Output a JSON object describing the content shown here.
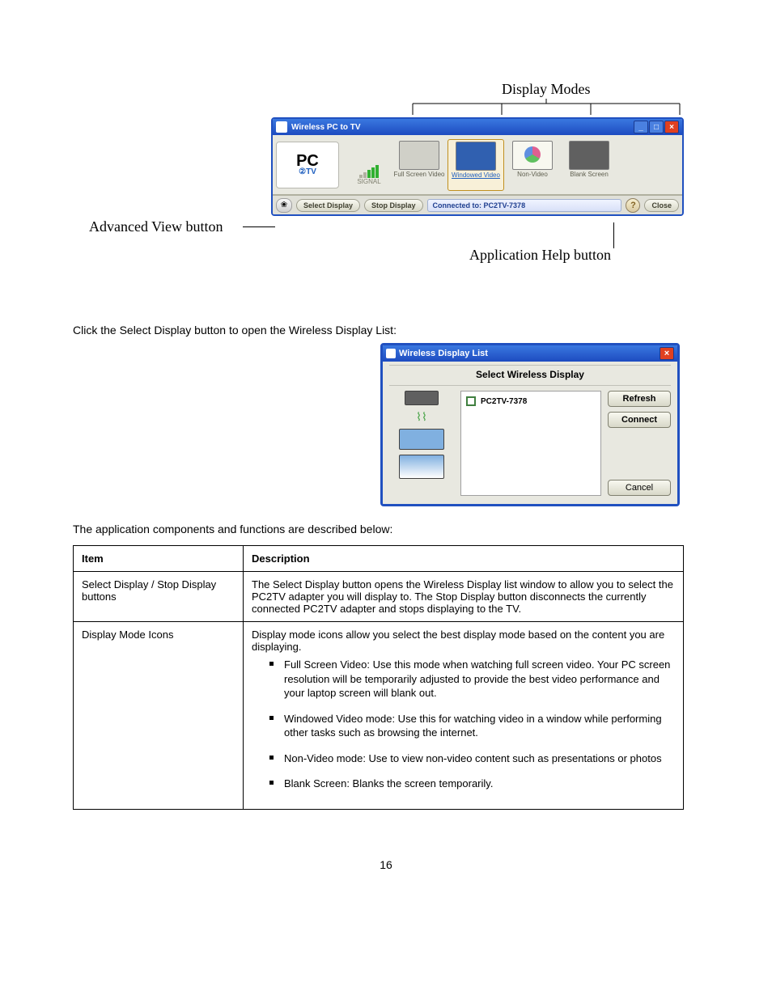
{
  "annotations": {
    "display_modes": "Display Modes",
    "advanced_view": "Advanced View button",
    "app_help": "Application Help button"
  },
  "app_window": {
    "title": "Wireless PC to TV",
    "logo_pc": "PC",
    "logo_sub": "②TV",
    "signal_label": "SIGNAL",
    "modes": {
      "full": "Full Screen Video",
      "windowed": "Windowed Video",
      "nonvideo": "Non-Video",
      "blank": "Blank Screen"
    },
    "adv_glyph": "❀",
    "select_display": "Select Display",
    "stop_display": "Stop Display",
    "connected": "Connected to: PC2TV-7378",
    "help_glyph": "?",
    "close": "Close"
  },
  "intro_line": "Click the Select Display button to open the Wireless Display List:",
  "dialog": {
    "title": "Wireless Display List",
    "header": "Select Wireless Display",
    "item": "PC2TV-7378",
    "refresh": "Refresh",
    "connect": "Connect",
    "cancel": "Cancel"
  },
  "after_dialog": "The application components and functions are described below:",
  "table": {
    "h_item": "Item",
    "h_desc": "Description",
    "r1_item": "Select Display / Stop Display buttons",
    "r1_desc": "The Select Display button opens the Wireless Display list window to allow you to select the PC2TV adapter you will display to. The Stop Display button disconnects the currently connected PC2TV adapter and stops displaying to the TV.",
    "r2_item": "Display Mode Icons",
    "r2_desc_intro": "Display mode icons allow you select the best display mode based on the content you are displaying.",
    "r2_bullets": [
      "Full Screen Video: Use this mode when watching full screen video.  Your PC screen resolution will be temporarily adjusted to provide the best video performance and your laptop screen will blank out.",
      "Windowed Video mode: Use this for watching video in a window while performing other tasks such as browsing the internet.",
      "Non-Video mode: Use to view non-video content such as presentations or photos",
      "Blank Screen: Blanks the screen temporarily."
    ]
  },
  "page_num": "16"
}
